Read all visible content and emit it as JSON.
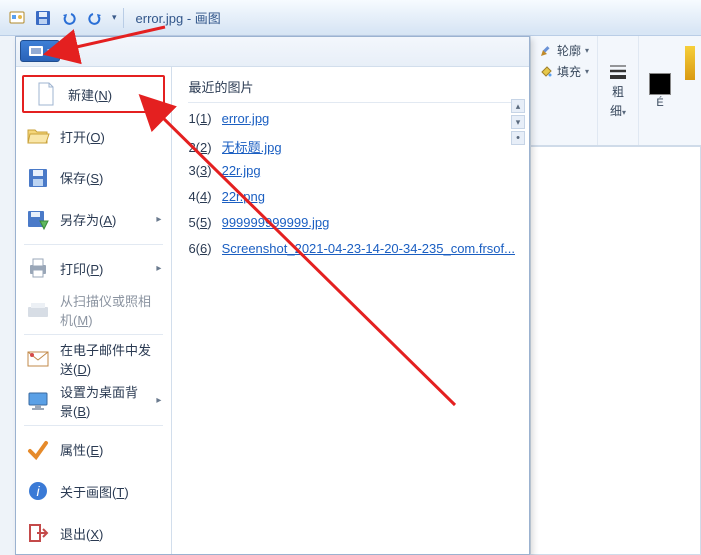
{
  "window": {
    "filename": "error.jpg",
    "appname": "画图"
  },
  "ribbon": {
    "outline": "轮廓",
    "fill": "填充",
    "thickness_line1": "粗",
    "thickness_line2": "细"
  },
  "file_menu": {
    "new": "新建",
    "new_key": "N",
    "open": "打开",
    "open_key": "O",
    "save": "保存",
    "save_key": "S",
    "save_as": "另存为",
    "save_as_key": "A",
    "print": "打印",
    "print_key": "P",
    "scan": "从扫描仪或照相机",
    "scan_key": "M",
    "email": "在电子邮件中发送",
    "email_key": "D",
    "wallpaper": "设置为桌面背景",
    "wallpaper_key": "B",
    "properties": "属性",
    "properties_key": "E",
    "about": "关于画图",
    "about_key": "T",
    "exit": "退出",
    "exit_key": "X"
  },
  "recent": {
    "title": "最近的图片",
    "items": [
      {
        "n": "1",
        "k": "1",
        "name": "error.jpg"
      },
      {
        "n": "2",
        "k": "2",
        "name": "无标题.jpg"
      },
      {
        "n": "3",
        "k": "3",
        "name": "22r.jpg"
      },
      {
        "n": "4",
        "k": "4",
        "name": "22r.png"
      },
      {
        "n": "5",
        "k": "5",
        "name": "999999999999.jpg"
      },
      {
        "n": "6",
        "k": "6",
        "name": "Screenshot_2021-04-23-14-20-34-235_com.frsof..."
      }
    ]
  }
}
